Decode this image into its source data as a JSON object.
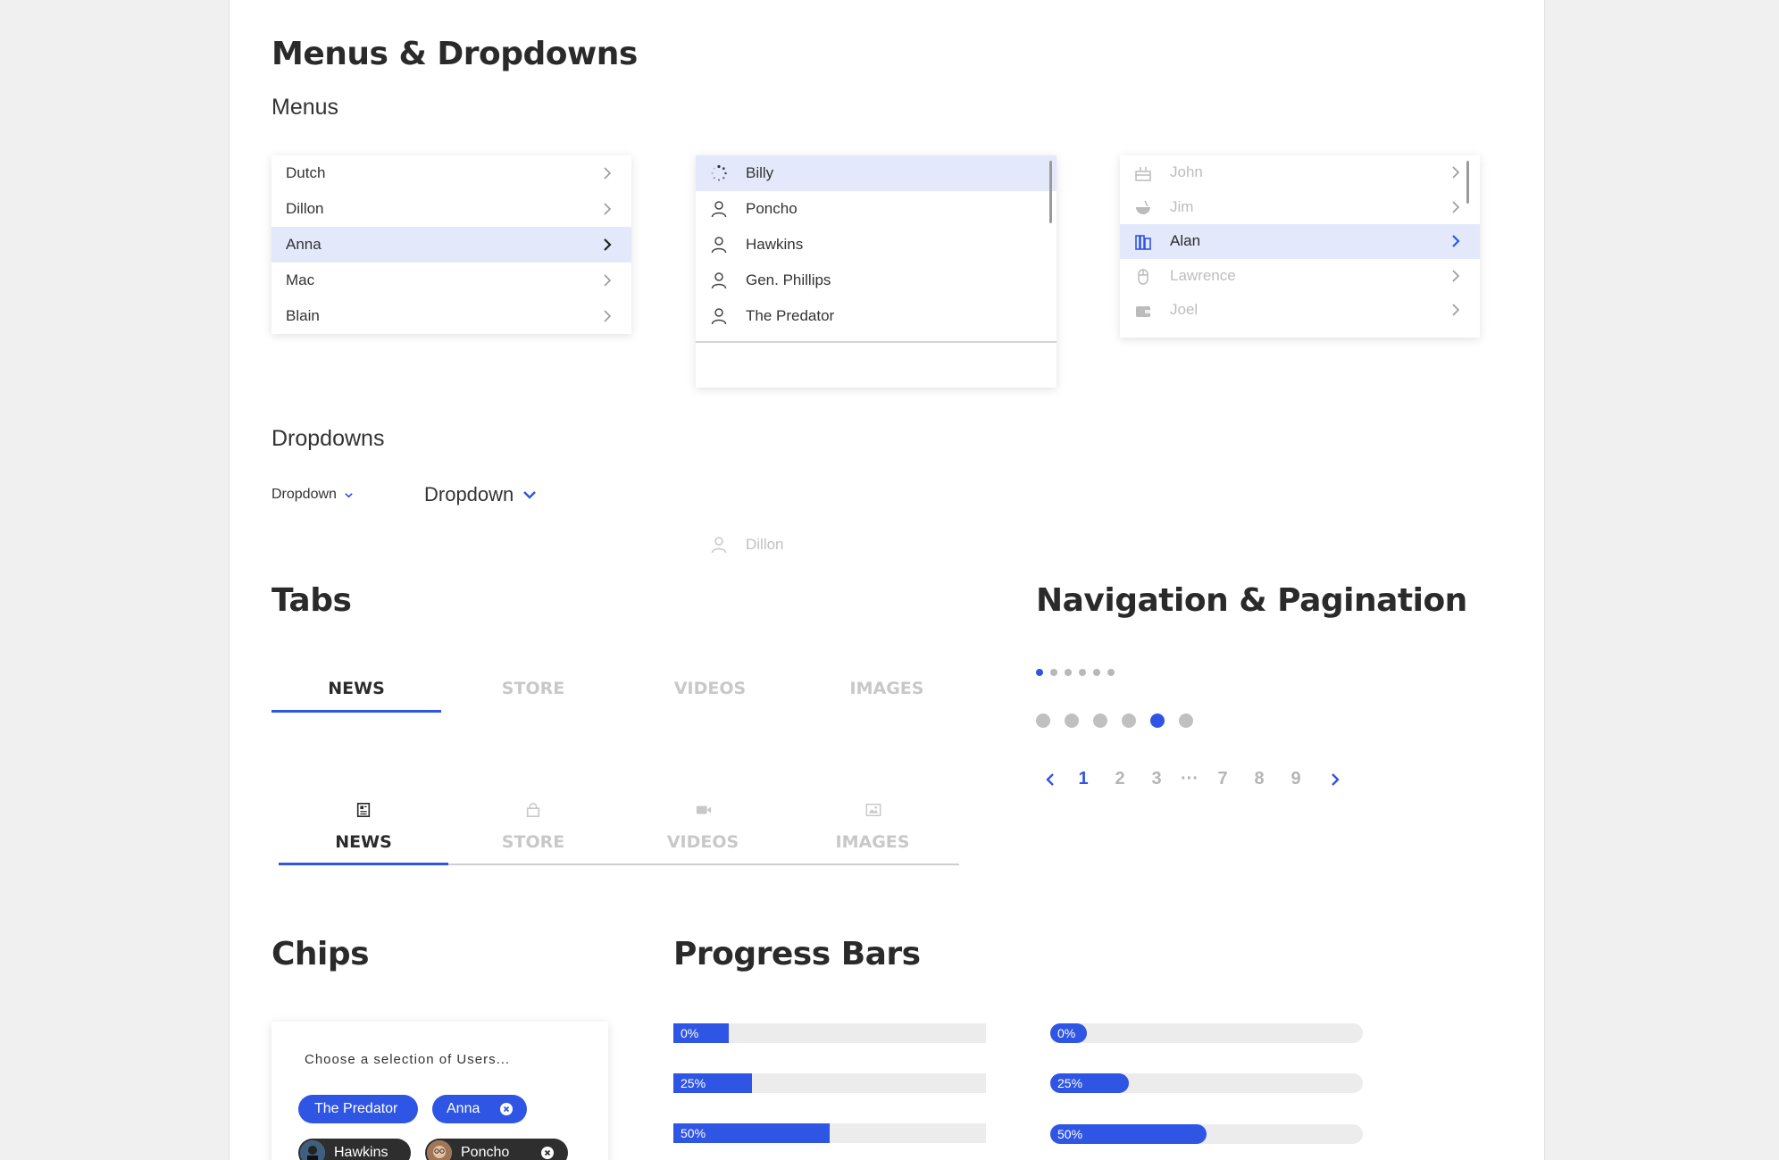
{
  "sections": {
    "menus_dropdowns": "Menus & Dropdowns",
    "menus": "Menus",
    "dropdowns": "Dropdowns",
    "tabs": "Tabs",
    "nav_pagination": "Navigation & Pagination",
    "chips": "Chips",
    "progress_bars": "Progress Bars"
  },
  "menu1": {
    "items": [
      {
        "label": "Dutch",
        "selected": false
      },
      {
        "label": "Dillon",
        "selected": false
      },
      {
        "label": "Anna",
        "selected": true
      },
      {
        "label": "Mac",
        "selected": false
      },
      {
        "label": "Blain",
        "selected": false
      }
    ]
  },
  "menu2": {
    "items": [
      {
        "label": "Billy",
        "icon": "loading-spinner-icon",
        "selected": true
      },
      {
        "label": "Poncho",
        "icon": "user-icon",
        "selected": false
      },
      {
        "label": "Hawkins",
        "icon": "user-icon",
        "selected": false
      },
      {
        "label": "Gen. Phillips",
        "icon": "user-icon",
        "selected": false
      },
      {
        "label": "The Predator",
        "icon": "user-icon",
        "selected": false
      }
    ],
    "disabled_item": {
      "label": "Dillon",
      "icon": "user-icon"
    }
  },
  "menu3": {
    "items": [
      {
        "label": "John",
        "icon": "cake-icon",
        "selected": false
      },
      {
        "label": "Jim",
        "icon": "bowl-icon",
        "selected": false
      },
      {
        "label": "Alan",
        "icon": "books-icon",
        "selected": true
      },
      {
        "label": "Lawrence",
        "icon": "mouse-icon",
        "selected": false
      },
      {
        "label": "Joel",
        "icon": "wallet-icon",
        "selected": false
      }
    ]
  },
  "dropdowns": {
    "small_label": "Dropdown",
    "large_label": "Dropdown"
  },
  "tabs_text": [
    "NEWS",
    "STORE",
    "VIDEOS",
    "IMAGES"
  ],
  "tabs_icon": [
    {
      "label": "NEWS",
      "icon": "newspaper-icon"
    },
    {
      "label": "STORE",
      "icon": "shopping-bag-icon"
    },
    {
      "label": "VIDEOS",
      "icon": "video-camera-icon"
    },
    {
      "label": "IMAGES",
      "icon": "image-icon"
    }
  ],
  "active_tab": "NEWS",
  "dots_small": {
    "count": 6,
    "active": 1
  },
  "dots_large": {
    "count": 6,
    "active": 5
  },
  "pagination": {
    "pages": [
      "1",
      "2",
      "3",
      "7",
      "8",
      "9"
    ],
    "ellipsis": "···",
    "current": "1"
  },
  "chips": {
    "placeholder": "Choose a selection of Users...",
    "items": [
      {
        "label": "The Predator",
        "style": "blue",
        "removable": false
      },
      {
        "label": "Anna",
        "style": "blue",
        "removable": true
      },
      {
        "label": "Hawkins",
        "style": "dark",
        "removable": false
      },
      {
        "label": "Poncho",
        "style": "dark",
        "removable": true
      }
    ]
  },
  "progress_square": [
    {
      "label": "0%",
      "percent": 0
    },
    {
      "label": "25%",
      "percent": 25
    },
    {
      "label": "50%",
      "percent": 50
    }
  ],
  "progress_round": [
    {
      "label": "0%",
      "percent": 0
    },
    {
      "label": "25%",
      "percent": 25
    },
    {
      "label": "50%",
      "percent": 50
    }
  ],
  "colors": {
    "accent": "#2f55e4",
    "selected_bg": "#e3e9fb",
    "dark_chip": "#2e2e2e",
    "track": "#ececec",
    "muted_text": "#bdbdbd"
  }
}
